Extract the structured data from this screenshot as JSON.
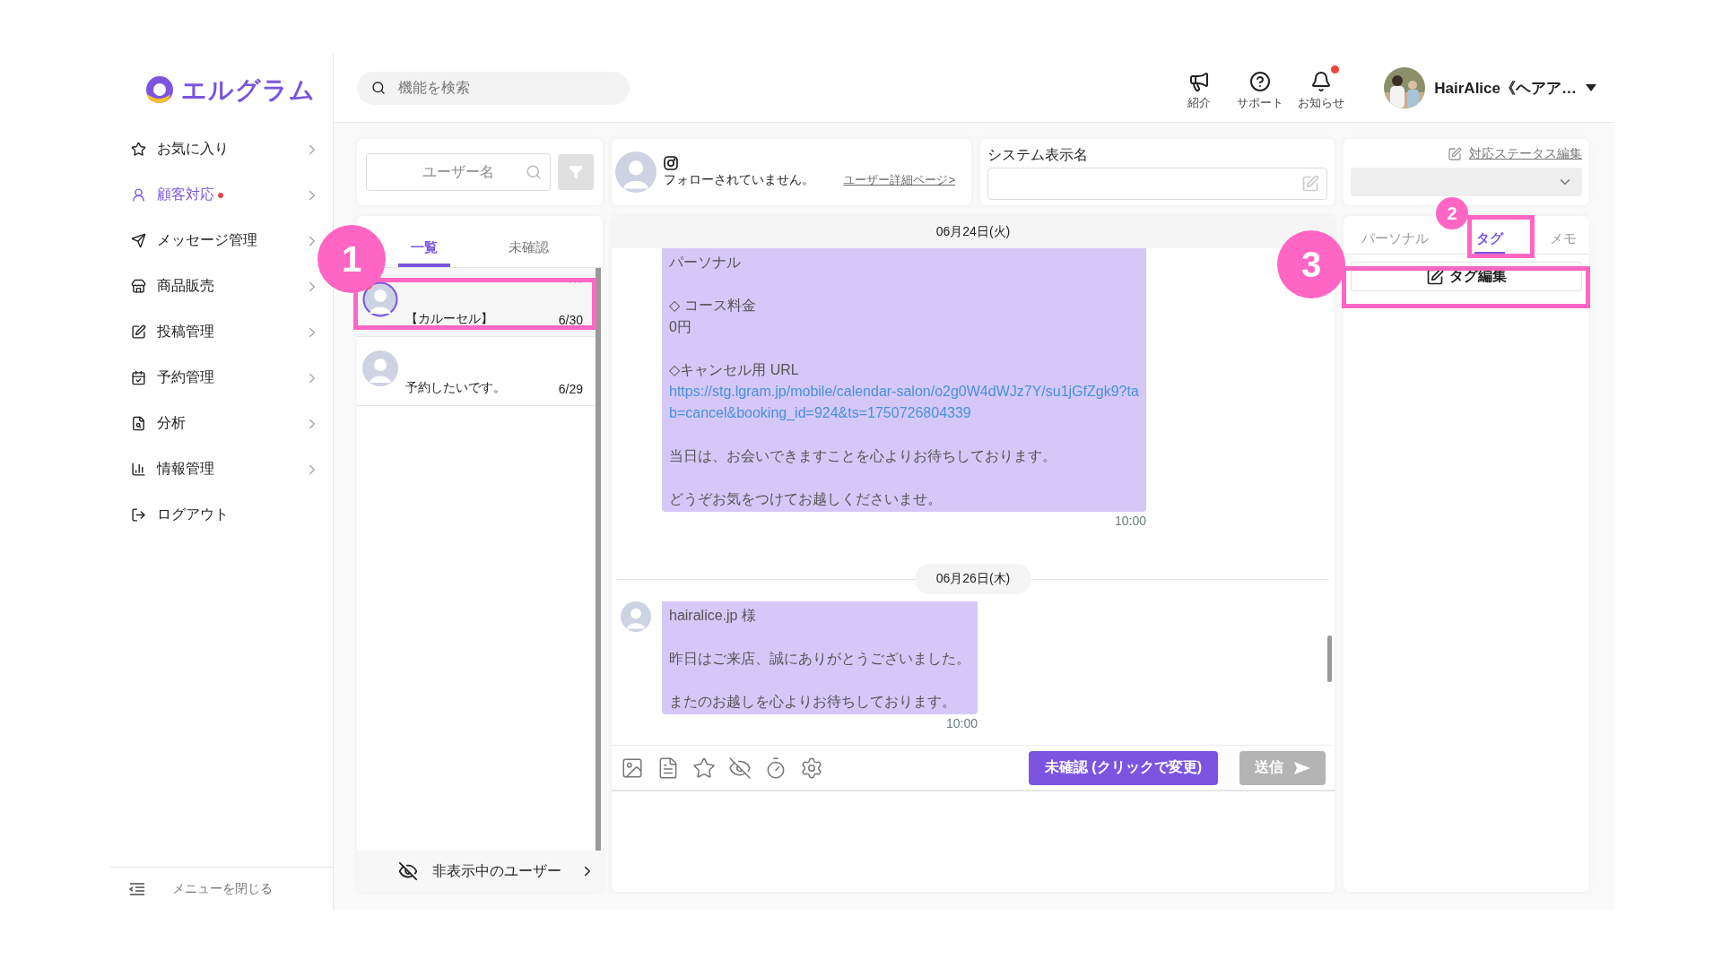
{
  "brand": {
    "name": "エルグラム"
  },
  "search": {
    "placeholder": "機能を検索"
  },
  "header_actions": [
    {
      "label": "紹介",
      "badge": false
    },
    {
      "label": "サポート",
      "badge": false
    },
    {
      "label": "お知らせ",
      "badge": true
    }
  ],
  "account": {
    "name": "HairAlice《ヘアア…"
  },
  "sidebar": {
    "items": [
      {
        "label": "お気に入り",
        "selected": false,
        "badge": false
      },
      {
        "label": "顧客対応",
        "selected": true,
        "badge": true
      },
      {
        "label": "メッセージ管理",
        "selected": false,
        "badge": false
      },
      {
        "label": "商品販売",
        "selected": false,
        "badge": false
      },
      {
        "label": "投稿管理",
        "selected": false,
        "badge": false
      },
      {
        "label": "予約管理",
        "selected": false,
        "badge": false
      },
      {
        "label": "分析",
        "selected": false,
        "badge": false
      },
      {
        "label": "情報管理",
        "selected": false,
        "badge": false
      },
      {
        "label": "ログアウト",
        "selected": false,
        "badge": false,
        "kind": "plain"
      }
    ],
    "collapse_label": "メニューを閉じる"
  },
  "user_search": {
    "placeholder": "ユーザー名"
  },
  "list_tabs": [
    {
      "label": "一覧",
      "selected": true
    },
    {
      "label": "未確認",
      "selected": false
    }
  ],
  "conversations": [
    {
      "preview": "【カルーセル】",
      "date": "6/30",
      "selected": true,
      "unread": true
    },
    {
      "preview": "予約したいです。",
      "date": "6/29",
      "selected": false,
      "unread": false
    }
  ],
  "hidden_users": {
    "label": "非表示中のユーザー"
  },
  "profile": {
    "follow_status": "フォローされていません。",
    "detail_link": "ユーザー詳細ページ>"
  },
  "system_name": {
    "label": "システム表示名"
  },
  "chat": {
    "sticky_date": "06月24日(火)",
    "items": [
      {
        "kind": "message",
        "show_avatar": false,
        "time": "10:00",
        "blocks": [
          {
            "kind": "text",
            "text": "パーソナル"
          },
          {
            "kind": "text",
            "text": "◇ コース料金\n0円"
          },
          {
            "kind": "text",
            "text": "◇キャンセル用 URL"
          },
          {
            "kind": "link",
            "text": "https://stg.lgram.jp/mobile/calendar-salon/o2g0W4dWJz7Y/su1jGfZgk9?tab=cancel&booking_id=924&ts=1750726804339"
          },
          {
            "kind": "text",
            "text": "当日は、お会いできますことを心よりお待ちしております。"
          },
          {
            "kind": "text",
            "text": "どうぞお気をつけてお越しくださいませ。"
          }
        ]
      },
      {
        "kind": "date",
        "label": "06月26日(木)"
      },
      {
        "kind": "message",
        "show_avatar": true,
        "time": "10:00",
        "blocks": [
          {
            "kind": "text",
            "text": "hairalice.jp 様"
          },
          {
            "kind": "text",
            "text": "昨日はご来店、誠にありがとうございました。"
          },
          {
            "kind": "text",
            "text": "またのお越しを心よりお待ちしております。"
          }
        ]
      }
    ]
  },
  "composer": {
    "status_button": "未確認 (クリックで変更)",
    "send": {
      "label": "送信",
      "disabled": true
    }
  },
  "right_panel": {
    "status_edit": "対応ステータス編集",
    "tabs": [
      {
        "label": "パーソナル",
        "selected": false
      },
      {
        "label": "タグ",
        "selected": true
      },
      {
        "label": "メモ",
        "selected": false
      }
    ],
    "tag_edit": "タグ編集"
  },
  "annotations": [
    {
      "label": "1"
    },
    {
      "label": "2"
    },
    {
      "label": "3"
    }
  ]
}
